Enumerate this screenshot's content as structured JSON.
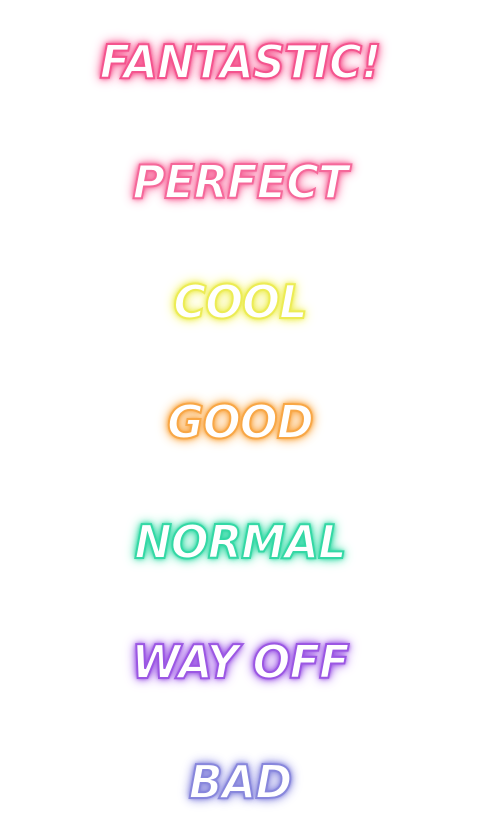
{
  "judgments": [
    {
      "label": "FANTASTIC!",
      "color": "#f4548e"
    },
    {
      "label": "PERFECT",
      "color": "#f5689a"
    },
    {
      "label": "COOL",
      "color": "#ecec55"
    },
    {
      "label": "GOOD",
      "color": "#f8a746"
    },
    {
      "label": "NORMAL",
      "color": "#34d8a5"
    },
    {
      "label": "WAY OFF",
      "color": "#9b57e3"
    },
    {
      "label": "BAD",
      "color": "#8887dc"
    }
  ]
}
